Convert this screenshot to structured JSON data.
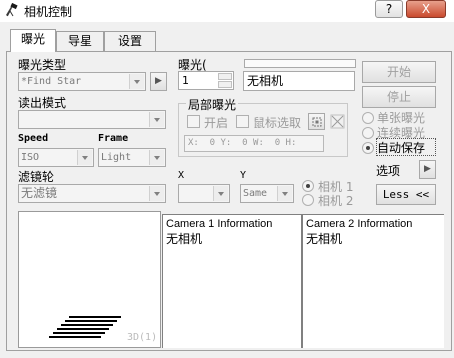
{
  "window": {
    "title": "相机控制",
    "minimize_label": "?",
    "close_label": "X"
  },
  "tabs": [
    {
      "label": "曝光"
    },
    {
      "label": "导星"
    },
    {
      "label": "设置"
    }
  ],
  "exposure": {
    "type_label": "曝光类型",
    "type_value": "*Find Star",
    "next_button_label": "▶",
    "readout_label": "读出模式",
    "readout_value": "",
    "speed_label": "Speed",
    "speed_value": "ISO",
    "frame_label": "Frame",
    "frame_value": "Light",
    "filter_wheel_label": "滤镜轮",
    "filter_wheel_value": "无滤镜",
    "exposure_label": "曝光(",
    "exposure_value": "1",
    "camera_status": "无相机"
  },
  "subframe": {
    "group_label": "局部曝光",
    "enable_label": "开启",
    "mouse_select_label": "鼠标选取",
    "coords_text": "X:  0 Y:  0 W:  0 H:"
  },
  "xy": {
    "x_label": "X",
    "y_label": "Y",
    "y_value": "Same"
  },
  "camera_select": {
    "camera1_label": "相机 1",
    "camera2_label": "相机 2"
  },
  "controls": {
    "start_label": "开始",
    "stop_label": "停止",
    "single_label": "单张曝光",
    "continuous_label": "连续曝光",
    "autosave_label": "自动保存",
    "options_label": "选项",
    "options_arrow": "▶",
    "less_label": "Less <<"
  },
  "info": {
    "camera1_title": "Camera 1 Information",
    "camera1_status": "无相机",
    "camera2_title": "Camera 2 Information",
    "camera2_status": "无相机"
  },
  "preview": {
    "label": "3D(1)"
  }
}
